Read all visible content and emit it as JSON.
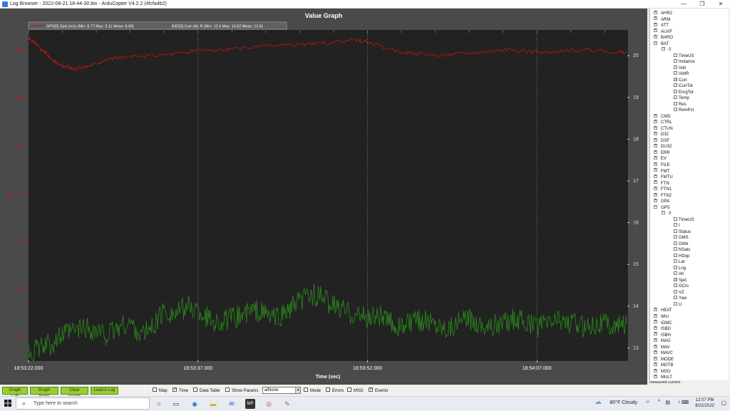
{
  "window": {
    "title": "Log Browser - 2022-08-21 18-44-30.bin - ArduCopter V4.2.2 (4fcfa4b2)",
    "minimize": "—",
    "maximize": "❐",
    "close": "✕"
  },
  "graph": {
    "title": "Value Graph",
    "legend": [
      {
        "label": "GPS[0].Spd (m/s)  (Min: 8.77 Max: 9.11 Mean: 8.99)",
        "color": "#cc1111"
      },
      {
        "label": "BAT[0].Curr (A): R (Min: 12.6 Max: 14.62 Mean: 13.6)",
        "color": "#2a8a1a"
      }
    ],
    "left_axis": {
      "label": "Y1",
      "ticks": [
        "9.0",
        "8.5",
        "8.0",
        "7.5",
        "7.0",
        "6.5",
        "6.0"
      ],
      "color": "#cc1111"
    },
    "right_axis": {
      "ticks": [
        "20",
        "19",
        "18",
        "17",
        "16",
        "15",
        "14",
        "13"
      ]
    },
    "x_axis": {
      "label": "Time (sec)",
      "ticks": [
        "18:53:22.000",
        "18:53:37.000",
        "18:53:52.000",
        "18:54:07.000"
      ]
    }
  },
  "chart_data": {
    "type": "line",
    "title": "Value Graph",
    "xlabel": "Time (sec)",
    "ylabel": "Y1",
    "x_ticks": [
      "18:53:22.000",
      "18:53:37.000",
      "18:53:52.000",
      "18:54:07.000"
    ],
    "x_range_sec": [
      0,
      53
    ],
    "ylim_left": [
      5.75,
      9.2
    ],
    "ylim_right": [
      12.7,
      20.6
    ],
    "grid": true,
    "legend_position": "top-left",
    "series": [
      {
        "name": "GPS[0].Spd (m/s)",
        "axis": "left",
        "color": "#cc1111",
        "x": [
          0,
          0.5,
          1,
          1.5,
          2,
          3,
          4,
          5,
          6,
          7,
          8,
          10,
          12,
          14,
          15,
          17,
          19,
          21,
          23,
          25,
          27,
          29,
          30,
          32,
          34,
          36,
          38,
          40,
          42,
          44,
          46,
          48,
          50,
          52,
          53
        ],
        "y": [
          9.12,
          9.08,
          9.02,
          8.97,
          8.9,
          8.83,
          8.8,
          8.82,
          8.86,
          8.9,
          8.92,
          8.93,
          8.95,
          8.97,
          9.0,
          8.99,
          9.02,
          9.04,
          9.05,
          9.06,
          9.07,
          9.1,
          9.08,
          9.0,
          8.96,
          8.94,
          8.96,
          8.98,
          9.0,
          8.98,
          8.97,
          8.99,
          9.0,
          8.98,
          8.97
        ]
      },
      {
        "name": "BAT[0].Curr (A): R",
        "axis": "right",
        "color": "#2a8a1a",
        "x": [
          0,
          1,
          2,
          3,
          4,
          5,
          6,
          7,
          8,
          9,
          10,
          11,
          12,
          13,
          14,
          15,
          16,
          17,
          18,
          19,
          20,
          21,
          22,
          23,
          24,
          25,
          26,
          27,
          28,
          29,
          30,
          31,
          32,
          33,
          34,
          35,
          36,
          37,
          38,
          39,
          40,
          41,
          42,
          43,
          44,
          45,
          46,
          47,
          48,
          49,
          50,
          51,
          52,
          53
        ],
        "y": [
          12.9,
          13.0,
          13.1,
          13.3,
          13.4,
          13.5,
          13.4,
          13.3,
          13.5,
          13.6,
          13.3,
          13.5,
          13.9,
          13.8,
          14.0,
          13.9,
          13.7,
          13.6,
          13.7,
          13.8,
          13.9,
          13.8,
          13.7,
          13.9,
          14.1,
          14.3,
          14.2,
          14.0,
          13.9,
          13.8,
          13.7,
          13.8,
          13.6,
          13.5,
          13.6,
          13.7,
          13.6,
          13.5,
          13.6,
          13.7,
          13.6,
          13.5,
          13.6,
          13.7,
          13.6,
          13.5,
          13.6,
          13.7,
          13.6,
          13.5,
          13.6,
          13.6,
          13.5,
          13.6
        ]
      }
    ]
  },
  "tree": {
    "top_items": [
      "AHR2",
      "ARM",
      "ATT",
      "AUXF",
      "BARO",
      "BAT"
    ],
    "bat_fields": [
      {
        "label": "TimeUS",
        "checked": false
      },
      {
        "label": "Instance",
        "checked": false
      },
      {
        "label": "Volt",
        "checked": false
      },
      {
        "label": "VoltR",
        "checked": false
      },
      {
        "label": "Curr",
        "checked": true
      },
      {
        "label": "CurrTot",
        "checked": false
      },
      {
        "label": "EnrgTot",
        "checked": false
      },
      {
        "label": "Temp",
        "checked": false
      },
      {
        "label": "Res",
        "checked": false
      },
      {
        "label": "RemPct",
        "checked": false
      }
    ],
    "mid_items": [
      "CMD",
      "CTRL",
      "CTUN",
      "D32",
      "DSF",
      "DU32",
      "ERR",
      "EV",
      "FILE",
      "FMT",
      "FMTU",
      "FTN",
      "FTN1",
      "FTN2",
      "GPA",
      "GPS"
    ],
    "gps_fields": [
      {
        "label": "TimeUS",
        "checked": false
      },
      {
        "label": "I",
        "checked": false
      },
      {
        "label": "Status",
        "checked": false
      },
      {
        "label": "GMS",
        "checked": false
      },
      {
        "label": "GWk",
        "checked": false
      },
      {
        "label": "NSats",
        "checked": false
      },
      {
        "label": "HDop",
        "checked": false
      },
      {
        "label": "Lat",
        "checked": false
      },
      {
        "label": "Lng",
        "checked": false
      },
      {
        "label": "Alt",
        "checked": false
      },
      {
        "label": "Spd",
        "checked": true
      },
      {
        "label": "GCrs",
        "checked": false
      },
      {
        "label": "VZ",
        "checked": false
      },
      {
        "label": "Yaw",
        "checked": false
      },
      {
        "label": "U",
        "checked": false
      }
    ],
    "instance_label": "0",
    "bottom_items": [
      "HEAT",
      "IMU",
      "IOMC",
      "ISBD",
      "ISBH",
      "MAG",
      "MAV",
      "MAVC",
      "MODE",
      "MOTB",
      "MSG",
      "MULT"
    ],
    "status": "measured current"
  },
  "bottombar": {
    "buttons": [
      "Graph Left",
      "Graph Right",
      "Clear Graph",
      "Load A Log"
    ],
    "checks": [
      {
        "label": "Map",
        "checked": false
      },
      {
        "label": "Time",
        "checked": true
      },
      {
        "label": "Data Table",
        "checked": false
      },
      {
        "label": "Show Params",
        "checked": false
      }
    ],
    "select_value": "a/None",
    "checks2": [
      {
        "label": "Mode",
        "checked": false
      },
      {
        "label": "Errors",
        "checked": false
      },
      {
        "label": "MSG",
        "checked": false
      },
      {
        "label": "Events",
        "checked": true
      }
    ]
  },
  "taskbar": {
    "search_placeholder": "Type here to search",
    "weather": "80°F  Cloudy",
    "time": "12:07 PM",
    "date": "8/22/2022"
  },
  "colors": {
    "plot_bg": "#222222",
    "frame_bg": "#4a4a4a",
    "accent_green": "#9acd32"
  }
}
